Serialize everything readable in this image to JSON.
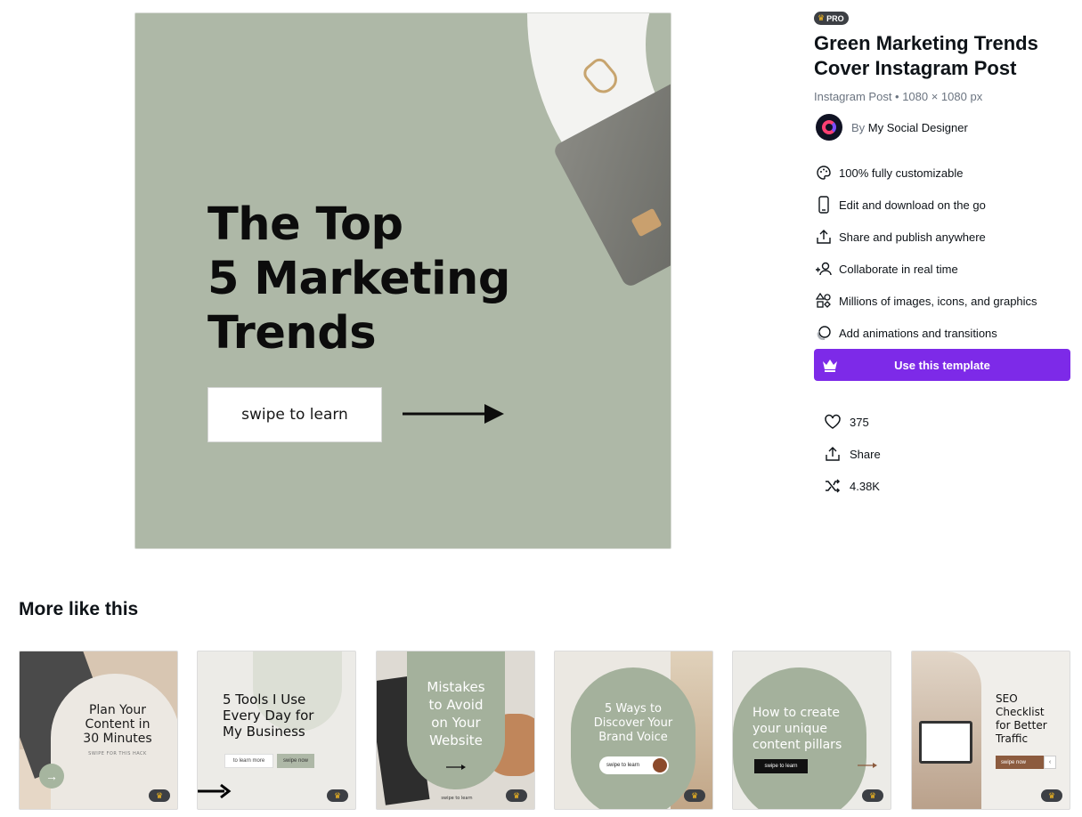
{
  "preview": {
    "headline": [
      "The Top",
      "5 Marketing",
      "Trends"
    ],
    "cta": "swipe to learn"
  },
  "side": {
    "badge": "PRO",
    "title": "Green Marketing Trends Cover Instagram Post",
    "meta": "Instagram Post • 1080 × 1080 px",
    "author_prefix": "By",
    "author_name": "My Social Designer",
    "features": [
      {
        "icon": "palette-icon",
        "label": "100% fully customizable"
      },
      {
        "icon": "phone-icon",
        "label": "Edit and download on the go"
      },
      {
        "icon": "share-icon",
        "label": "Share and publish anywhere"
      },
      {
        "icon": "people-icon",
        "label": "Collaborate in real time"
      },
      {
        "icon": "shapes-icon",
        "label": "Millions of images, icons, and graphics"
      },
      {
        "icon": "animation-icon",
        "label": "Add animations and transitions"
      }
    ],
    "use_button": "Use this template",
    "stats": {
      "likes": "375",
      "share": "Share",
      "remixes": "4.38K"
    }
  },
  "more": {
    "title": "More like this",
    "thumbs": [
      {
        "lines": [
          "Plan Your",
          "Content in",
          "30 Minutes"
        ],
        "sub": "SWIPE FOR THIS HACK"
      },
      {
        "lines": [
          "5 Tools I Use",
          "Every Day for",
          "My Business"
        ],
        "btn1": "to learn more",
        "btn2": "swipe now"
      },
      {
        "lines": [
          "Mistakes",
          "to Avoid",
          "on Your",
          "Website"
        ],
        "sub": "swipe to learn"
      },
      {
        "lines": [
          "5 Ways to",
          "Discover Your",
          "Brand Voice"
        ],
        "btn": "swipe to learn"
      },
      {
        "lines": [
          "How to create",
          "your unique",
          "content pillars"
        ],
        "btn": "swipe to learn"
      },
      {
        "lines": [
          "SEO",
          "Checklist",
          "for Better",
          "Traffic"
        ],
        "btn": "swipe now"
      }
    ]
  },
  "colors": {
    "accent": "#7d2ae8",
    "sage": "#aeb8a7",
    "pro_crown": "#fdbf1e"
  }
}
